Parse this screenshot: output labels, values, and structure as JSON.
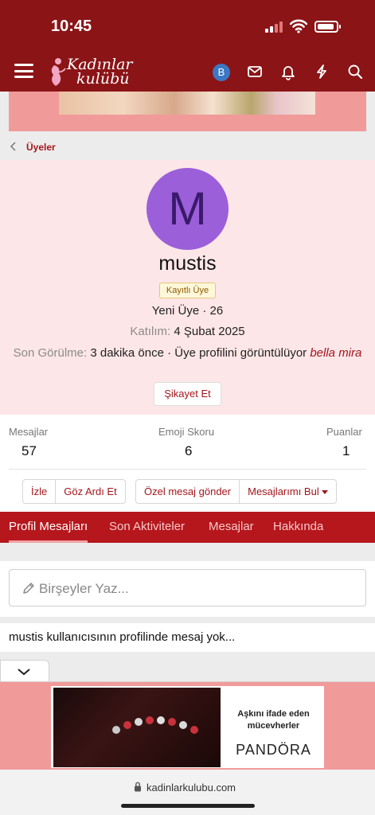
{
  "status_bar": {
    "time": "10:45"
  },
  "header": {
    "logo_line1": "Kadınlar",
    "logo_line2": "kulübü",
    "user_initial": "B"
  },
  "breadcrumb": {
    "label": "Üyeler"
  },
  "profile": {
    "avatar_letter": "M",
    "username": "mustis",
    "badge": "Kayıtlı Üye",
    "user_title": "Yeni Üye · 26",
    "joined_label": "Katılım:",
    "joined_value": "4 Şubat 2025",
    "last_seen_label": "Son Görülme:",
    "last_seen_value": "3 dakika önce · Üye profilini görüntülüyor",
    "last_seen_link": "bella mira",
    "report_button": "Şikayet Et"
  },
  "stats": [
    {
      "label": "Mesajlar",
      "value": "57"
    },
    {
      "label": "Emoji Skoru",
      "value": "6"
    },
    {
      "label": "Puanlar",
      "value": "1"
    }
  ],
  "actions": {
    "follow": "İzle",
    "ignore": "Göz Ardı Et",
    "private_message": "Özel mesaj gönder",
    "find_messages": "Mesajlarımı Bul"
  },
  "tabs": [
    {
      "label": "Profil Mesajları",
      "active": true
    },
    {
      "label": "Son Aktiviteler",
      "active": false
    },
    {
      "label": "Mesajlar",
      "active": false
    },
    {
      "label": "Hakkında",
      "active": false
    }
  ],
  "post_box": {
    "placeholder": "Birşeyler Yaz..."
  },
  "empty_message": "mustis kullanıcısının profilinde mesaj yok...",
  "ad": {
    "headline_line1": "Aşkını ifade eden",
    "headline_line2": "mücevherler",
    "brand": "PANDÖRA"
  },
  "url_bar": {
    "url": "kadinlarkulubu.com"
  },
  "colors": {
    "header": "#8b1417",
    "accent": "#a3161c",
    "tabs": "#b5171d",
    "profile_bg": "#fde6e8",
    "avatar": "#9b5fd9"
  }
}
